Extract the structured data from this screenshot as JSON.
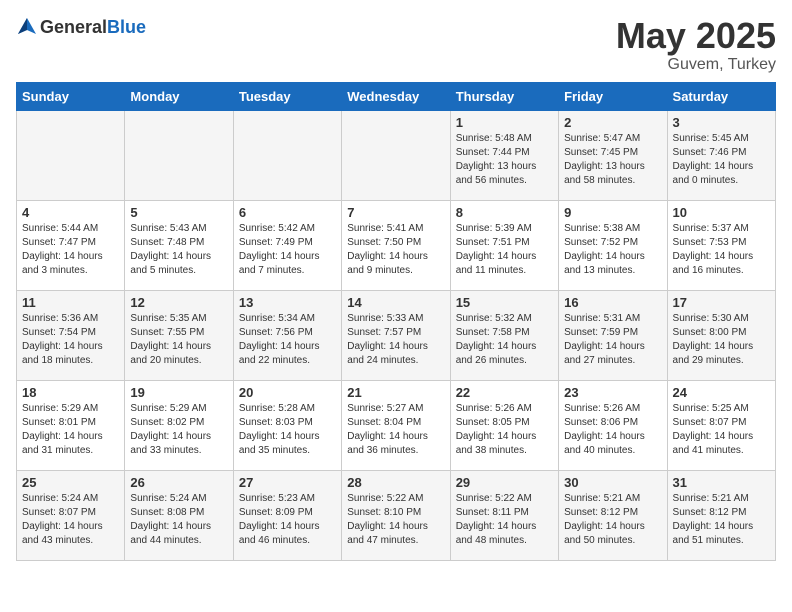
{
  "header": {
    "logo_general": "General",
    "logo_blue": "Blue",
    "month_title": "May 2025",
    "subtitle": "Guvem, Turkey"
  },
  "weekdays": [
    "Sunday",
    "Monday",
    "Tuesday",
    "Wednesday",
    "Thursday",
    "Friday",
    "Saturday"
  ],
  "weeks": [
    [
      {
        "day": "",
        "info": ""
      },
      {
        "day": "",
        "info": ""
      },
      {
        "day": "",
        "info": ""
      },
      {
        "day": "",
        "info": ""
      },
      {
        "day": "1",
        "info": "Sunrise: 5:48 AM\nSunset: 7:44 PM\nDaylight: 13 hours\nand 56 minutes."
      },
      {
        "day": "2",
        "info": "Sunrise: 5:47 AM\nSunset: 7:45 PM\nDaylight: 13 hours\nand 58 minutes."
      },
      {
        "day": "3",
        "info": "Sunrise: 5:45 AM\nSunset: 7:46 PM\nDaylight: 14 hours\nand 0 minutes."
      }
    ],
    [
      {
        "day": "4",
        "info": "Sunrise: 5:44 AM\nSunset: 7:47 PM\nDaylight: 14 hours\nand 3 minutes."
      },
      {
        "day": "5",
        "info": "Sunrise: 5:43 AM\nSunset: 7:48 PM\nDaylight: 14 hours\nand 5 minutes."
      },
      {
        "day": "6",
        "info": "Sunrise: 5:42 AM\nSunset: 7:49 PM\nDaylight: 14 hours\nand 7 minutes."
      },
      {
        "day": "7",
        "info": "Sunrise: 5:41 AM\nSunset: 7:50 PM\nDaylight: 14 hours\nand 9 minutes."
      },
      {
        "day": "8",
        "info": "Sunrise: 5:39 AM\nSunset: 7:51 PM\nDaylight: 14 hours\nand 11 minutes."
      },
      {
        "day": "9",
        "info": "Sunrise: 5:38 AM\nSunset: 7:52 PM\nDaylight: 14 hours\nand 13 minutes."
      },
      {
        "day": "10",
        "info": "Sunrise: 5:37 AM\nSunset: 7:53 PM\nDaylight: 14 hours\nand 16 minutes."
      }
    ],
    [
      {
        "day": "11",
        "info": "Sunrise: 5:36 AM\nSunset: 7:54 PM\nDaylight: 14 hours\nand 18 minutes."
      },
      {
        "day": "12",
        "info": "Sunrise: 5:35 AM\nSunset: 7:55 PM\nDaylight: 14 hours\nand 20 minutes."
      },
      {
        "day": "13",
        "info": "Sunrise: 5:34 AM\nSunset: 7:56 PM\nDaylight: 14 hours\nand 22 minutes."
      },
      {
        "day": "14",
        "info": "Sunrise: 5:33 AM\nSunset: 7:57 PM\nDaylight: 14 hours\nand 24 minutes."
      },
      {
        "day": "15",
        "info": "Sunrise: 5:32 AM\nSunset: 7:58 PM\nDaylight: 14 hours\nand 26 minutes."
      },
      {
        "day": "16",
        "info": "Sunrise: 5:31 AM\nSunset: 7:59 PM\nDaylight: 14 hours\nand 27 minutes."
      },
      {
        "day": "17",
        "info": "Sunrise: 5:30 AM\nSunset: 8:00 PM\nDaylight: 14 hours\nand 29 minutes."
      }
    ],
    [
      {
        "day": "18",
        "info": "Sunrise: 5:29 AM\nSunset: 8:01 PM\nDaylight: 14 hours\nand 31 minutes."
      },
      {
        "day": "19",
        "info": "Sunrise: 5:29 AM\nSunset: 8:02 PM\nDaylight: 14 hours\nand 33 minutes."
      },
      {
        "day": "20",
        "info": "Sunrise: 5:28 AM\nSunset: 8:03 PM\nDaylight: 14 hours\nand 35 minutes."
      },
      {
        "day": "21",
        "info": "Sunrise: 5:27 AM\nSunset: 8:04 PM\nDaylight: 14 hours\nand 36 minutes."
      },
      {
        "day": "22",
        "info": "Sunrise: 5:26 AM\nSunset: 8:05 PM\nDaylight: 14 hours\nand 38 minutes."
      },
      {
        "day": "23",
        "info": "Sunrise: 5:26 AM\nSunset: 8:06 PM\nDaylight: 14 hours\nand 40 minutes."
      },
      {
        "day": "24",
        "info": "Sunrise: 5:25 AM\nSunset: 8:07 PM\nDaylight: 14 hours\nand 41 minutes."
      }
    ],
    [
      {
        "day": "25",
        "info": "Sunrise: 5:24 AM\nSunset: 8:07 PM\nDaylight: 14 hours\nand 43 minutes."
      },
      {
        "day": "26",
        "info": "Sunrise: 5:24 AM\nSunset: 8:08 PM\nDaylight: 14 hours\nand 44 minutes."
      },
      {
        "day": "27",
        "info": "Sunrise: 5:23 AM\nSunset: 8:09 PM\nDaylight: 14 hours\nand 46 minutes."
      },
      {
        "day": "28",
        "info": "Sunrise: 5:22 AM\nSunset: 8:10 PM\nDaylight: 14 hours\nand 47 minutes."
      },
      {
        "day": "29",
        "info": "Sunrise: 5:22 AM\nSunset: 8:11 PM\nDaylight: 14 hours\nand 48 minutes."
      },
      {
        "day": "30",
        "info": "Sunrise: 5:21 AM\nSunset: 8:12 PM\nDaylight: 14 hours\nand 50 minutes."
      },
      {
        "day": "31",
        "info": "Sunrise: 5:21 AM\nSunset: 8:12 PM\nDaylight: 14 hours\nand 51 minutes."
      }
    ]
  ]
}
